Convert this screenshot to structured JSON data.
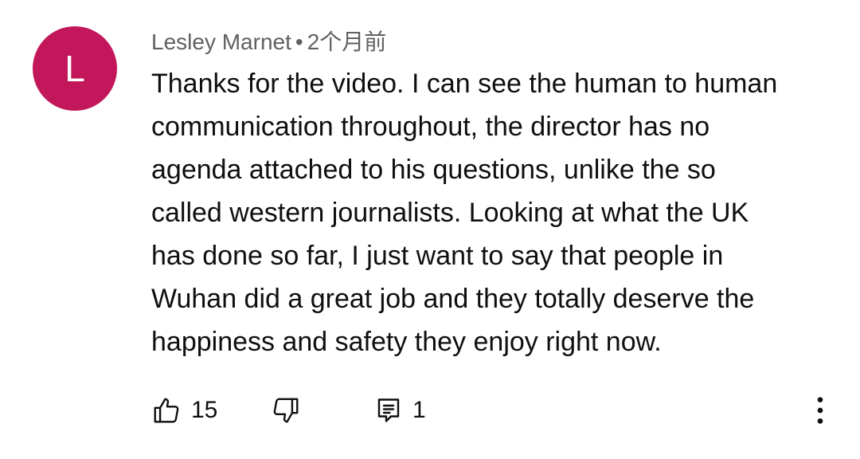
{
  "comment": {
    "avatar_letter": "L",
    "avatar_color": "#c2185b",
    "author": "Lesley Marnet",
    "separator": "•",
    "time": "2个月前",
    "text_lines": [
      "Thanks for the video. I can see the human to human",
      "communication throughout, the director has no",
      "agenda attached to his questions, unlike the so",
      "called western journalists. Looking at what the UK",
      "has done so far, I just want to say that people in",
      "Wuhan did a great job and they totally deserve the",
      "happiness and safety they enjoy right now."
    ],
    "actions": {
      "like_icon": "thumbs-up-icon",
      "like_count": "15",
      "dislike_icon": "thumbs-down-icon",
      "reply_icon": "reply-icon",
      "reply_count": "1",
      "more_icon": "more-vertical-icon"
    }
  }
}
